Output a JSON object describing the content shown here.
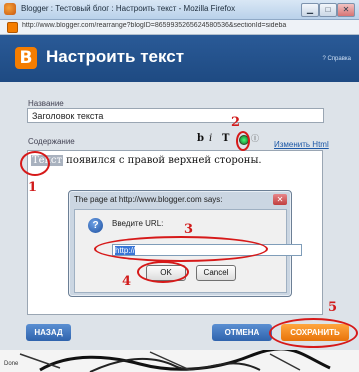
{
  "window": {
    "title": "Blogger : Тестовый блог : Настроить текст - Mozilla Firefox",
    "url": "http://www.blogger.com/rearrange?blogID=8659935265624580536&sectionId=sideba",
    "minimize": "▁",
    "maximize": "□",
    "close": "✕"
  },
  "header": {
    "logo_letter": "B",
    "title": "Настроить текст",
    "help": "? Справка"
  },
  "form": {
    "title_label": "Название",
    "title_value": "Заголовок текста",
    "content_label": "Содержание",
    "toolbar": {
      "bold": "b",
      "italic": "i",
      "text": "T",
      "image": "Ⓘ"
    },
    "edit_html": "Изменить Html",
    "content_text": {
      "selected": "Текст",
      "rest": " появился с правой верхней стороны."
    }
  },
  "dialog": {
    "title": "The page at http://www.blogger.com says:",
    "close": "✕",
    "icon": "?",
    "label": "Введите URL:",
    "input_value": "http://",
    "ok": "OK",
    "cancel": "Cancel"
  },
  "buttons": {
    "back": "НАЗАД",
    "cancel": "ОТМЕНА",
    "save": "СОХРАНИТЬ"
  },
  "annotations": [
    "1",
    "2",
    "3",
    "4",
    "5"
  ],
  "status": "Done",
  "colors": {
    "header_blue": "#2a5a97",
    "annotation_red": "#d61919",
    "save_orange": "#f08a1f"
  },
  "icons": [
    "firefox-icon",
    "blogger-icon",
    "question-icon",
    "link-icon"
  ]
}
